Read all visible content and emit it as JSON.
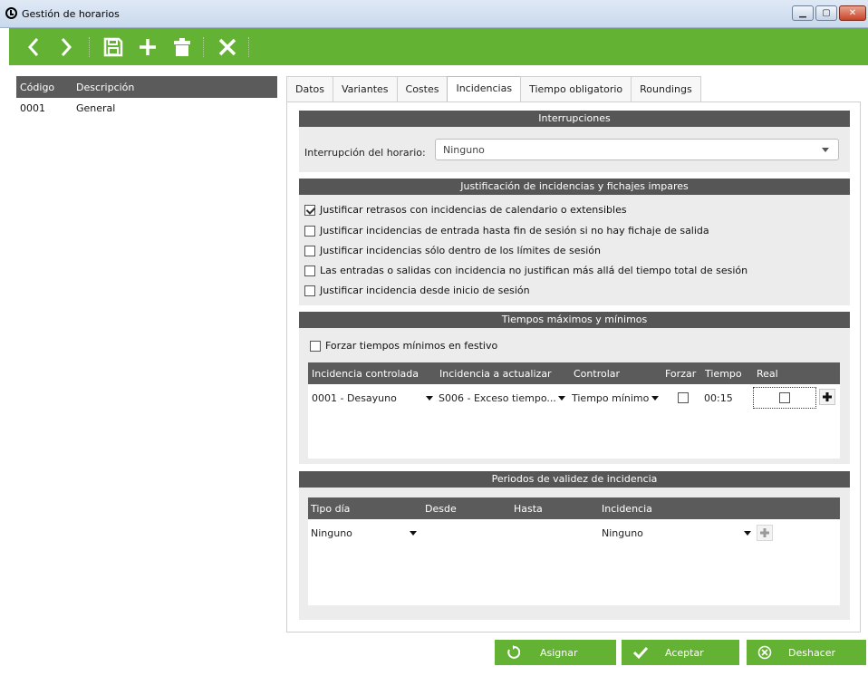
{
  "window": {
    "title": "Gestión de horarios"
  },
  "left_table": {
    "headers": [
      "Código",
      "Descripción"
    ],
    "rows": [
      {
        "codigo": "0001",
        "descripcion": "General"
      }
    ]
  },
  "tabs": [
    {
      "label": "Datos"
    },
    {
      "label": "Variantes"
    },
    {
      "label": "Costes"
    },
    {
      "label": "Incidencias"
    },
    {
      "label": "Tiempo obligatorio"
    },
    {
      "label": "Roundings"
    }
  ],
  "interrupciones": {
    "title": "Interrupciones",
    "label": "Interrupción del horario:",
    "value": "Ninguno"
  },
  "justificacion": {
    "title": "Justificación de incidencias y fichajes impares",
    "options": [
      {
        "label": "Justificar retrasos con incidencias de calendario o extensibles",
        "checked": true
      },
      {
        "label": "Justificar incidencias de entrada hasta fin de sesión si no hay fichaje de salida",
        "checked": false
      },
      {
        "label": "Justificar incidencias sólo dentro de los límites de sesión",
        "checked": false
      },
      {
        "label": "Las entradas o salidas con incidencia no justifican más allá del tiempo total de sesión",
        "checked": false
      },
      {
        "label": "Justificar incidencia desde inicio de sesión",
        "checked": false
      }
    ]
  },
  "tiempos": {
    "title": "Tiempos máximos y mínimos",
    "forzar_label": "Forzar tiempos mínimos en festivo",
    "forzar_checked": false,
    "headers": [
      "Incidencia controlada",
      "Incidencia a actualizar",
      "Controlar",
      "Forzar",
      "Tiempo",
      "Real"
    ],
    "rows": [
      {
        "controlada": "0001 - Desayuno",
        "actualizar": "S006 - Exceso tiempo...",
        "controlar": "Tiempo mínimo",
        "forzar": false,
        "tiempo": "00:15",
        "real": false
      }
    ]
  },
  "periodos": {
    "title": "Periodos de validez de incidencia",
    "headers": [
      "Tipo día",
      "Desde",
      "Hasta",
      "Incidencia"
    ],
    "rows": [
      {
        "tipo_dia": "Ninguno",
        "incidencia": "Ninguno"
      }
    ]
  },
  "buttons": {
    "asignar": "Asignar",
    "aceptar": "Aceptar",
    "deshacer": "Deshacer"
  },
  "colors": {
    "accent": "#64b234",
    "header_dark": "#5b5b5b",
    "section_bg": "#ececec"
  }
}
